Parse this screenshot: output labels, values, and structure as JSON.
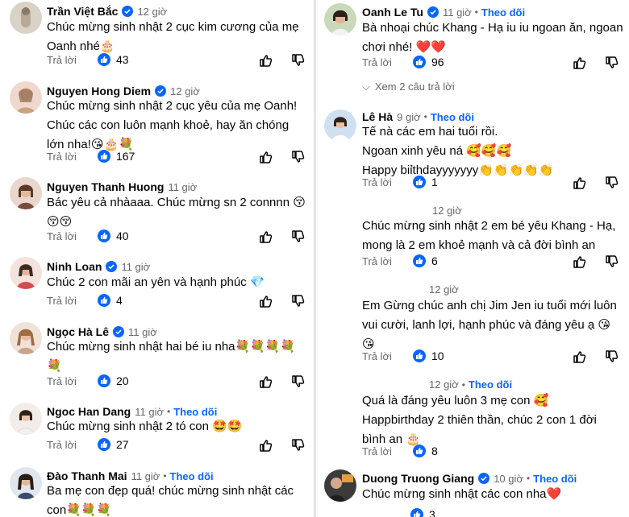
{
  "left": [
    {
      "name": "Trần Việt Bắc",
      "verified": true,
      "time": "12 giờ",
      "follow": "",
      "lines": [
        "Chúc mừng sinh nhật 2 cục kim cương của mẹ",
        "Oanh nhé🎂"
      ],
      "reply": "Trả lời",
      "likes": "43"
    },
    {
      "name": "Nguyen Hong Diem",
      "verified": true,
      "time": "12 giờ",
      "follow": "",
      "lines": [
        "Chúc mừng sinh nhật 2 cục yêu của mẹ Oanh!",
        "Chúc các con luôn mạnh khoẻ, hay ăn chóng",
        "lớn nha!😘🎂💐"
      ],
      "reply": "Trả lời",
      "likes": "167"
    },
    {
      "name": "Nguyen Thanh Huong",
      "verified": false,
      "time": "11 giờ",
      "follow": "",
      "lines": [
        "Bác yêu cả nhàaaa. Chúc mừng sn 2 connnn 😚",
        "😚😚"
      ],
      "reply": "Trả lời",
      "likes": "40"
    },
    {
      "name": "Ninh Loan",
      "verified": true,
      "time": "11 giờ",
      "follow": "",
      "lines": [
        "Chúc 2 con mãi an yên và hạnh phúc 💎"
      ],
      "reply": "Trả lời",
      "likes": "4"
    },
    {
      "name": "Ngọc Hà Lê",
      "verified": true,
      "time": "11 giờ",
      "follow": "",
      "lines": [
        "Chúc mừng sinh nhật hai bé iu nha💐💐💐💐",
        "💐"
      ],
      "reply": "Trả lời",
      "likes": "20"
    },
    {
      "name": "Ngoc Han Dang",
      "verified": false,
      "time": "11 giờ",
      "follow": "Theo dõi",
      "lines": [
        "Chúc mừng sinh nhật 2 tó con 🤩🤩"
      ],
      "reply": "Trả lời",
      "likes": "27"
    },
    {
      "name": "Đào Thanh Mai",
      "verified": false,
      "time": "11 giờ",
      "follow": "Theo dõi",
      "lines": [
        "Ba mẹ con đẹp quá! chúc mừng sinh nhật các",
        "con💐💐💐"
      ],
      "reply": "",
      "likes": ""
    }
  ],
  "right": [
    {
      "name": "Oanh Le Tu",
      "verified": true,
      "time": "11 giờ",
      "follow": "Theo dõi",
      "lines": [
        "Bà nhoại chúc Khang - Hạ iu iu ngoan ăn, ngoan",
        "chơi nhé! ❤️❤️"
      ],
      "reply": "Trả lời",
      "likes": "96",
      "see_replies": "Xem 2 câu trả lời"
    },
    {
      "name": "Lê Hà",
      "verified": false,
      "time": "9 giờ",
      "follow": "Theo dõi",
      "lines": [
        "Tế nà các em hai tuổi rồi.",
        "Ngoan xinh yêu ná 🥰🥰🥰",
        "Happy biỉthdayyyyyyy👏👏👏👏👏"
      ],
      "reply": "Trả lời",
      "likes": "1"
    },
    {
      "name": "",
      "verified": false,
      "time": "12 giờ",
      "follow": "",
      "lines": [
        "Chúc mừng sinh nhật 2 em bé yêu Khang - Hạ,",
        "mong là 2 em khoẻ mạnh và cả đời bình an"
      ],
      "reply": "Trả lời",
      "likes": "6"
    },
    {
      "name": "",
      "verified": false,
      "time": "12 giờ",
      "follow": "",
      "lines": [
        "Em Gừng chúc anh chị Jim Jen iu tuổi mới luôn",
        "vui cười, lanh lợi, hạnh phúc và đáng yêu ạ 😘",
        "😘"
      ],
      "reply": "Trả lời",
      "likes": "10"
    },
    {
      "name": "",
      "verified": false,
      "time": "12 giờ",
      "follow": "Theo dõi",
      "lines": [
        "Quá là đáng yêu luôn 3 mẹ con 🥰",
        "Happbirthday 2 thiên thần, chúc 2 con 1 đời",
        "bình an 🎂"
      ],
      "reply": "Trả lời",
      "likes": "8"
    },
    {
      "name": "Duong Truong Giang",
      "verified": true,
      "time": "10 giờ",
      "follow": "Theo dõi",
      "lines": [
        "Chúc mừng sinh nhật các con nha❤️"
      ],
      "reply": "",
      "likes": "3"
    }
  ],
  "colors": {
    "accent": "#0866ff",
    "secondary_text": "#65676b",
    "verified": "#0866ff"
  }
}
